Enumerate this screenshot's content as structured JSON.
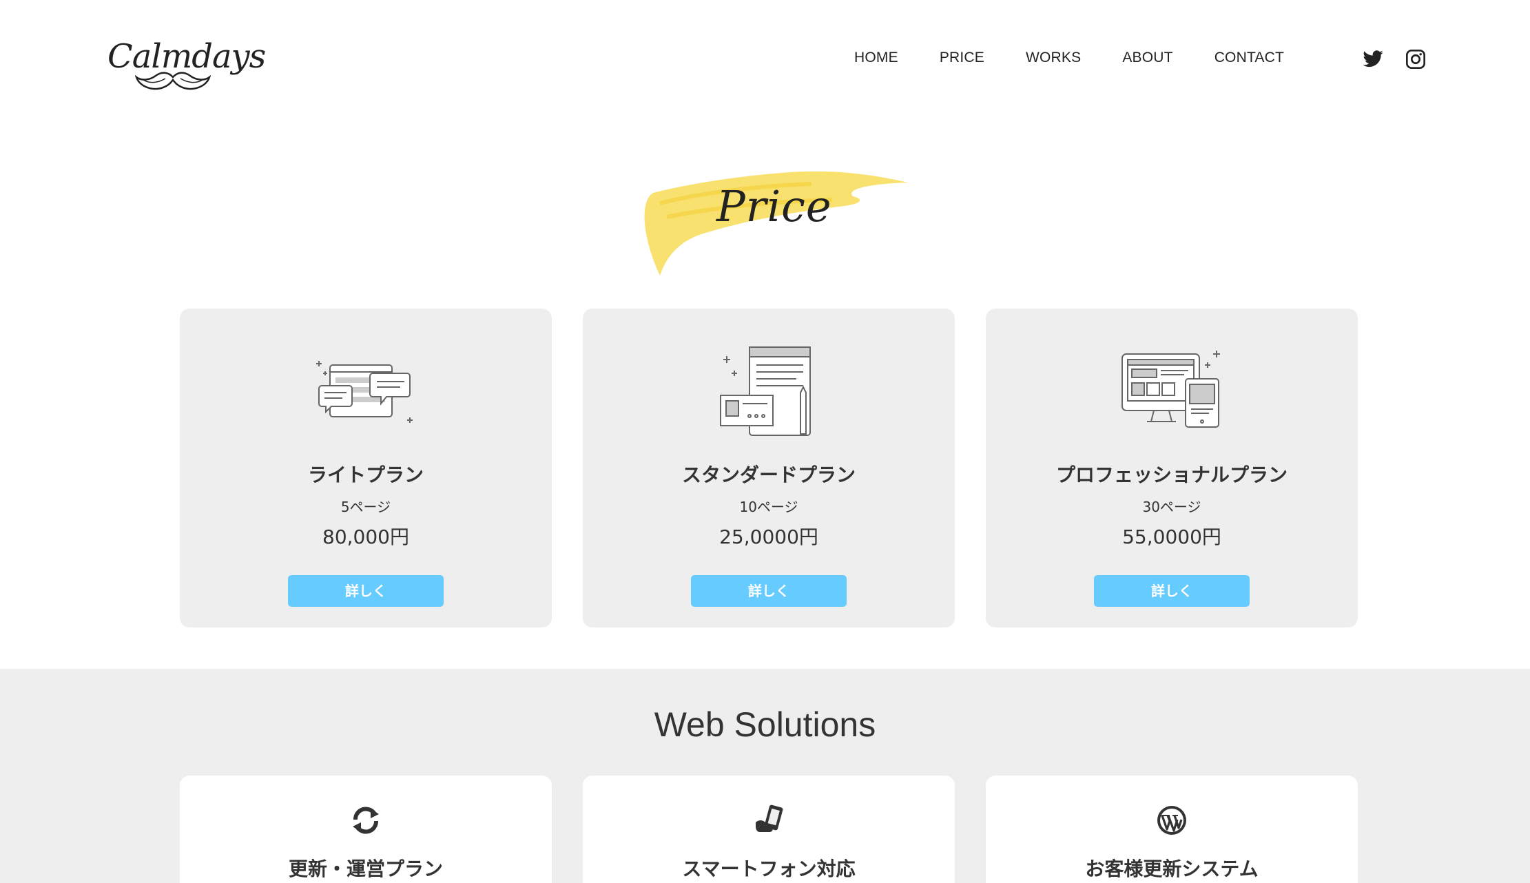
{
  "header": {
    "logo_text": "Calmdays",
    "nav": [
      "HOME",
      "PRICE",
      "WORKS",
      "ABOUT",
      "CONTACT"
    ],
    "social": [
      "twitter-icon",
      "instagram-icon"
    ]
  },
  "price_section": {
    "title": "Price",
    "plans": [
      {
        "name": "ライトプラン",
        "pages": "5ページ",
        "price": "80,000円",
        "button": "詳しく",
        "icon": "chat-window-illustration"
      },
      {
        "name": "スタンダードプラン",
        "pages": "10ページ",
        "price": "25,0000円",
        "button": "詳しく",
        "icon": "document-pencil-illustration"
      },
      {
        "name": "プロフェッショナルプラン",
        "pages": "30ページ",
        "price": "55,0000円",
        "button": "詳しく",
        "icon": "devices-illustration"
      }
    ]
  },
  "solutions": {
    "title": "Web Solutions",
    "items": [
      {
        "name": "更新・運営プラン",
        "icon": "refresh-icon"
      },
      {
        "name": "スマートフォン対応",
        "icon": "smartphone-icon"
      },
      {
        "name": "お客様更新システム",
        "icon": "wordpress-icon"
      }
    ]
  },
  "colors": {
    "button": "#66ccff",
    "card_bg": "#eeeeee",
    "section_bg": "#eeeeee",
    "brush": "#f7dc55"
  }
}
